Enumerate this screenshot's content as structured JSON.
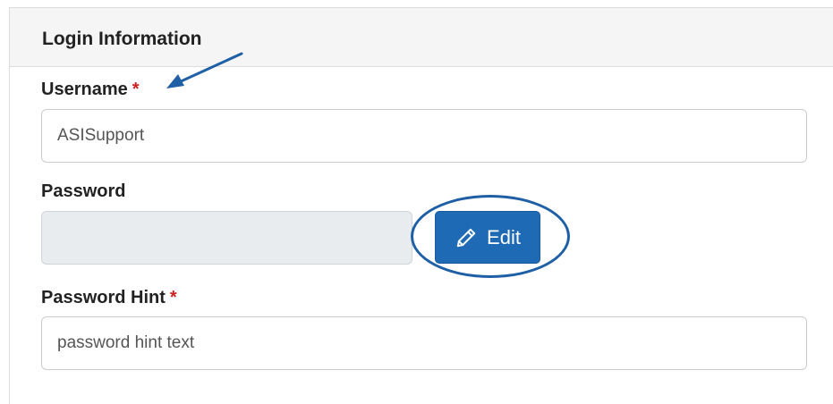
{
  "panel": {
    "title": "Login Information"
  },
  "username": {
    "label": "Username",
    "required_mark": "*",
    "value": "ASISupport"
  },
  "password": {
    "label": "Password",
    "value": "",
    "edit_button_label": "Edit",
    "edit_icon": "pencil-icon"
  },
  "password_hint": {
    "label": "Password Hint",
    "required_mark": "*",
    "value": "password hint text"
  },
  "colors": {
    "accent": "#1f6ab5",
    "required": "#cc1f1f",
    "annotation": "#1f5fa5"
  }
}
